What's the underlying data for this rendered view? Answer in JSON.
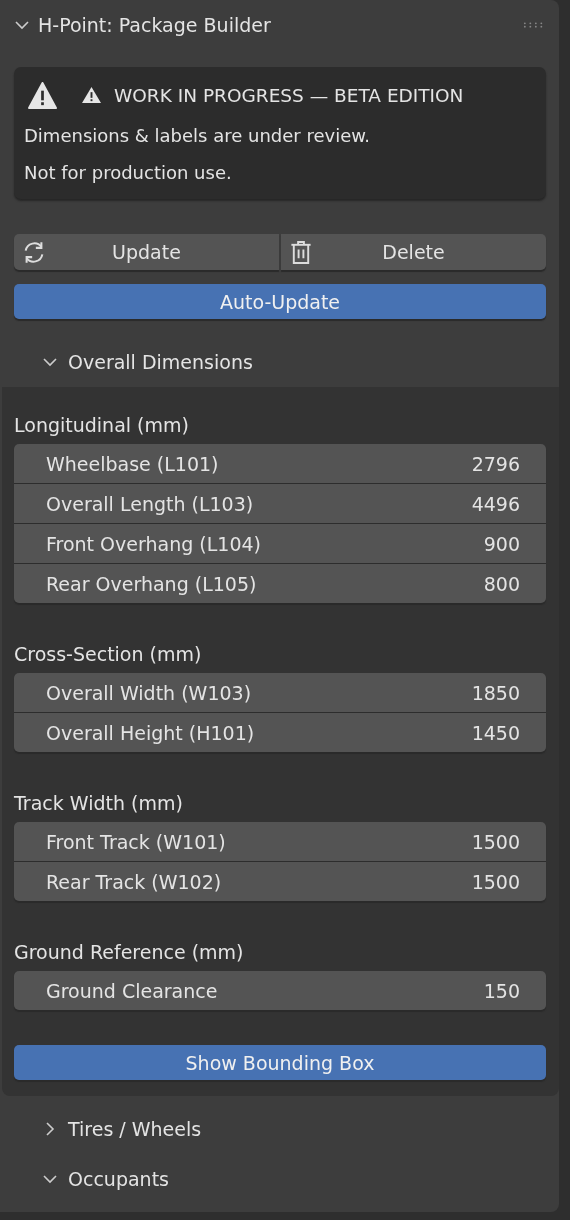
{
  "panel": {
    "title": "H-Point: Package Builder",
    "expanded": true
  },
  "warning": {
    "title": "WORK IN PROGRESS — BETA EDITION",
    "lines": [
      "Dimensions & labels are under review.",
      "Not for production use."
    ]
  },
  "actions": [
    {
      "label": "Update",
      "kind": "refresh"
    },
    {
      "label": "Delete",
      "kind": "delete"
    }
  ],
  "auto_update": {
    "label": "Auto-Update",
    "on": true
  },
  "subpanels": [
    {
      "title": "Overall Dimensions",
      "expanded": true,
      "groups": [
        {
          "label": "Longitudinal (mm)",
          "fields": [
            {
              "label": "Wheelbase (L101)",
              "value": "2796"
            },
            {
              "label": "Overall Length (L103)",
              "value": "4496"
            },
            {
              "label": "Front Overhang (L104)",
              "value": "900"
            },
            {
              "label": "Rear Overhang (L105)",
              "value": "800"
            }
          ]
        },
        {
          "label": "Cross-Section (mm)",
          "fields": [
            {
              "label": "Overall Width (W103)",
              "value": "1850"
            },
            {
              "label": "Overall Height (H101)",
              "value": "1450"
            }
          ]
        },
        {
          "label": "Track Width (mm)",
          "fields": [
            {
              "label": "Front Track (W101)",
              "value": "1500"
            },
            {
              "label": "Rear Track (W102)",
              "value": "1500"
            }
          ]
        },
        {
          "label": "Ground Reference (mm)",
          "fields": [
            {
              "label": "Ground Clearance",
              "value": "150"
            }
          ]
        }
      ],
      "toggle": {
        "label": "Show Bounding Box",
        "on": true
      }
    },
    {
      "title": "Tires / Wheels",
      "expanded": false
    },
    {
      "title": "Occupants",
      "expanded": true
    }
  ]
}
